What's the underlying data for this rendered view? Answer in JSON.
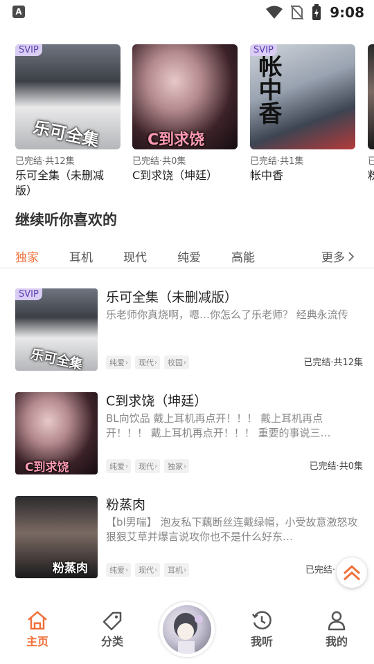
{
  "status_bar": {
    "time": "9:08",
    "app_badge": "A"
  },
  "carousel": {
    "items": [
      {
        "badge": "SVIP",
        "cover_text": "乐可全集",
        "meta": "已完结·共12集",
        "title": "乐可全集（未删减版）"
      },
      {
        "badge": "",
        "cover_text": "C到求饶",
        "meta": "已完结·共0集",
        "title": "C到求饶（坤廷）"
      },
      {
        "badge": "SVIP",
        "cover_text": "帐中香",
        "meta": "已完结·共1集",
        "title": "帐中香"
      },
      {
        "badge": "",
        "cover_text": "",
        "meta": "已",
        "title": "粉"
      }
    ]
  },
  "section": {
    "title": "继续听你喜欢的"
  },
  "tabs": {
    "items": [
      "独家",
      "耳机",
      "现代",
      "纯爱",
      "高能"
    ],
    "more_label": "更多",
    "active_color": "#f0703a"
  },
  "list": {
    "items": [
      {
        "badge": "SVIP",
        "cover_text": "乐可全集",
        "title": "乐可全集（未删减版）",
        "desc": "乐老师你真烧啊，嗯…你怎么了乐老师？ 经典永流传",
        "tags": [
          "纯爱",
          "现代",
          "校园"
        ],
        "status": "已完结·共12集"
      },
      {
        "badge": "",
        "cover_text": "C到求饶",
        "title": "C到求饶（坤廷）",
        "desc": "BL向饮品 戴上耳机再点开！！！ 戴上耳机再点开！！！ 戴上耳机再点开！！！ 重要的事说三…",
        "tags": [
          "纯爱",
          "现代",
          "独家"
        ],
        "status": "已完结·共0集"
      },
      {
        "badge": "",
        "cover_text": "粉蒸肉",
        "title": "粉蒸肉",
        "desc": "【bl男喘】 泡友私下藕断丝连戴绿帽，小受故意激怒攻 狠狠艾草并爆言说攻你也不是什么好东…",
        "tags": [
          "纯爱",
          "现代",
          "耳机"
        ],
        "status": "已完结·"
      }
    ]
  },
  "bottom_nav": {
    "items": [
      {
        "label": "主页",
        "icon": "home-icon",
        "active": true
      },
      {
        "label": "分类",
        "icon": "tag-icon",
        "active": false
      },
      {
        "label": "我听",
        "icon": "history-clock-icon",
        "active": false
      },
      {
        "label": "我的",
        "icon": "user-icon",
        "active": false
      }
    ]
  }
}
